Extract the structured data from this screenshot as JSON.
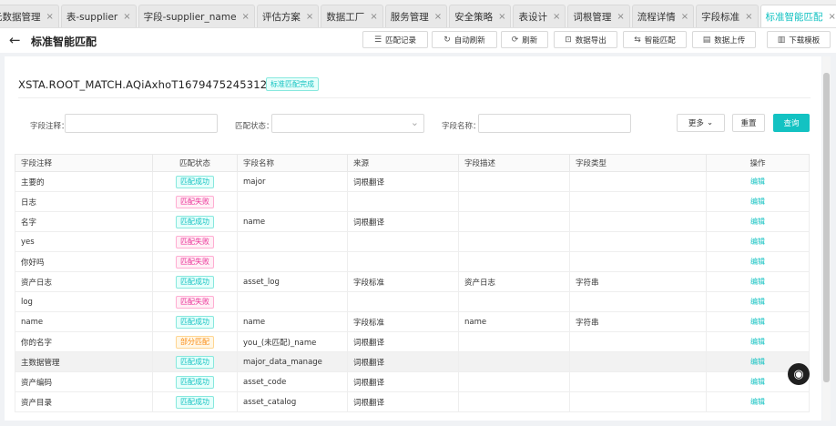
{
  "tabs": [
    {
      "label": "元数据管理",
      "active": false
    },
    {
      "label": "表-supplier",
      "active": false
    },
    {
      "label": "字段-supplier_name",
      "active": false
    },
    {
      "label": "评估方案",
      "active": false
    },
    {
      "label": "数据工厂",
      "active": false
    },
    {
      "label": "服务管理",
      "active": false
    },
    {
      "label": "安全策略",
      "active": false
    },
    {
      "label": "表设计",
      "active": false
    },
    {
      "label": "词根管理",
      "active": false
    },
    {
      "label": "流程详情",
      "active": false
    },
    {
      "label": "字段标准",
      "active": false
    },
    {
      "label": "标准智能匹配",
      "active": true
    }
  ],
  "tab_close_glyph": "×",
  "header": {
    "back_glyph": "←",
    "title": "标准智能匹配",
    "buttons": [
      {
        "label": "匹配记录",
        "icon": "list-icon",
        "glyph": "☰"
      },
      {
        "label": "自动刷新",
        "icon": "refresh-icon",
        "glyph": "↻"
      },
      {
        "label": "刷新",
        "icon": "sync-icon",
        "glyph": "⟳"
      },
      {
        "label": "数据导出",
        "icon": "export-icon",
        "glyph": "⊡"
      },
      {
        "label": "智能匹配",
        "icon": "match-icon",
        "glyph": "⇆"
      },
      {
        "label": "数据上传",
        "icon": "upload-icon",
        "glyph": "▤"
      },
      {
        "label": "下载模板",
        "icon": "download-icon",
        "glyph": "▥"
      }
    ]
  },
  "record": {
    "id": "XSTA.ROOT_MATCH.AQiAxhoT1679475245312",
    "status_badge": "标准匹配完成"
  },
  "filters": {
    "field_comment_label": "字段注释：",
    "match_status_label": "匹配状态：",
    "field_name_label": "字段名称：",
    "more_label": "更多",
    "more_glyph": "⌄",
    "select_glyph": "⌄",
    "reset_label": "重置",
    "query_label": "查询"
  },
  "table": {
    "columns": [
      "字段注释",
      "匹配状态",
      "字段名称",
      "来源",
      "字段描述",
      "字段类型",
      "操作"
    ],
    "op_label": "编辑",
    "rows": [
      {
        "comment": "主要的",
        "status": "匹配成功",
        "status_type": "ok",
        "name": "major",
        "source": "词根翻译",
        "desc": "",
        "type": ""
      },
      {
        "comment": "日志",
        "status": "匹配失败",
        "status_type": "fail",
        "name": "",
        "source": "",
        "desc": "",
        "type": ""
      },
      {
        "comment": "名字",
        "status": "匹配成功",
        "status_type": "ok",
        "name": "name",
        "source": "词根翻译",
        "desc": "",
        "type": ""
      },
      {
        "comment": "yes",
        "status": "匹配失败",
        "status_type": "fail",
        "name": "",
        "source": "",
        "desc": "",
        "type": ""
      },
      {
        "comment": "你好吗",
        "status": "匹配失败",
        "status_type": "fail",
        "name": "",
        "source": "",
        "desc": "",
        "type": ""
      },
      {
        "comment": "资产日志",
        "status": "匹配成功",
        "status_type": "ok",
        "name": "asset_log",
        "source": "字段标准",
        "desc": "资产日志",
        "type": "字符串"
      },
      {
        "comment": "log",
        "status": "匹配失败",
        "status_type": "fail",
        "name": "",
        "source": "",
        "desc": "",
        "type": ""
      },
      {
        "comment": "name",
        "status": "匹配成功",
        "status_type": "ok",
        "name": "name",
        "source": "字段标准",
        "desc": "name",
        "type": "字符串"
      },
      {
        "comment": "你的名字",
        "status": "部分匹配",
        "status_type": "part",
        "name": "you_(未匹配)_name",
        "source": "词根翻译",
        "desc": "",
        "type": ""
      },
      {
        "comment": "主数据管理",
        "status": "匹配成功",
        "status_type": "ok",
        "name": "major_data_manage",
        "source": "词根翻译",
        "desc": "",
        "type": "",
        "highlight": true
      },
      {
        "comment": "资产编码",
        "status": "匹配成功",
        "status_type": "ok",
        "name": "asset_code",
        "source": "词根翻译",
        "desc": "",
        "type": ""
      },
      {
        "comment": "资产目录",
        "status": "匹配成功",
        "status_type": "ok",
        "name": "asset_catalog",
        "source": "词根翻译",
        "desc": "",
        "type": ""
      }
    ]
  },
  "float_button_glyph": "◉",
  "colors": {
    "accent": "#13c2c2",
    "fail": "#eb2f96",
    "partial": "#fa8c16"
  }
}
